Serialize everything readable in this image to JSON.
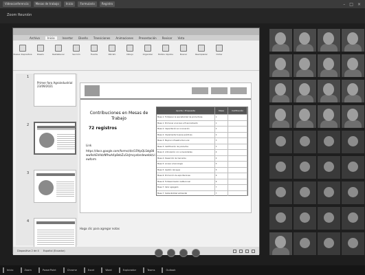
{
  "top_tabs": [
    "Videoconferencia",
    "Mesas de trabajo",
    "Inicio",
    "Formulario",
    "Registro"
  ],
  "meeting": {
    "title": "Zoom Reunión"
  },
  "powerpoint": {
    "tabs": [
      "Archivo",
      "Inicio",
      "Insertar",
      "Diseño",
      "Transiciones",
      "Animaciones",
      "Presentación",
      "Revisar",
      "Vista"
    ],
    "ribbon": [
      "Nueva diapositiva",
      "Diseño",
      "Restablecer",
      "Sección",
      "Fuente",
      "Párrafo",
      "Dibujo",
      "Organizar",
      "Estilos rápidos",
      "Buscar",
      "Reemplazar",
      "Dictar"
    ],
    "thumbs": [
      {
        "num": "1",
        "title": "Primer foro Agroindustrial 23/09/2021"
      },
      {
        "num": "2",
        "title": ""
      },
      {
        "num": "3",
        "title": ""
      },
      {
        "num": "4",
        "title": ""
      }
    ],
    "slide": {
      "heading": "Contribuciones en Mesas de Trabajo",
      "count": "72 registros",
      "link_label": "Link",
      "link": "https://docs.google.com/forms/d/e/1FAIpQLSdg08ww9ohEhAdzNfhwh4p8ebZuSlcJmcpnbndewebk/viewform",
      "table_headers": [
        "Aporte / Propuesta",
        "Mesa",
        "Calificación"
      ],
      "table_rows": [
        [
          "Mesa 1: Fortalecer la asociatividad de productores",
          "1",
          ""
        ],
        [
          "Mesa 1: Promover el acceso a financiamiento",
          "1",
          ""
        ],
        [
          "Mesa 2: Capacitación en innovación",
          "2",
          ""
        ],
        [
          "Mesa 2: Implementar buenas prácticas",
          "2",
          ""
        ],
        [
          "Mesa 3: Mejorar infraestructura vial",
          "3",
          ""
        ],
        [
          "Mesa 3: Certificación de productos",
          "3",
          ""
        ],
        [
          "Mesa 4: Articulación con universidades",
          "4",
          ""
        ],
        [
          "Mesa 4: Desarrollo de mercados",
          "4",
          ""
        ],
        [
          "Mesa 5: Acceso a tecnología",
          "5",
          ""
        ],
        [
          "Mesa 5: Gestión del agua",
          "5",
          ""
        ],
        [
          "Mesa 6: Promoción de exportaciones",
          "6",
          ""
        ],
        [
          "Mesa 6: Fortalecimiento institucional",
          "6",
          ""
        ],
        [
          "Mesa 7: Valor agregado",
          "7",
          ""
        ],
        [
          "Mesa 7: Sostenibilidad ambiental",
          "7",
          ""
        ]
      ]
    },
    "notes": "Haga clic para agregar notas",
    "status": {
      "slide_info": "Diapositiva 2 de 4",
      "language": "Español (Ecuador)"
    }
  },
  "participants": [
    {
      "name": "",
      "type": "video"
    },
    {
      "name": "",
      "type": "video"
    },
    {
      "name": "",
      "type": "video"
    },
    {
      "name": "",
      "type": "video"
    },
    {
      "name": "",
      "type": "video"
    },
    {
      "name": "",
      "type": "video"
    },
    {
      "name": "",
      "type": "video"
    },
    {
      "name": "",
      "type": "video"
    },
    {
      "name": "",
      "type": "video"
    },
    {
      "name": "",
      "type": "video"
    },
    {
      "name": "",
      "type": "video"
    },
    {
      "name": "",
      "type": "video"
    },
    {
      "name": "",
      "type": "video"
    },
    {
      "name": "",
      "type": "video"
    },
    {
      "name": "",
      "type": "video"
    },
    {
      "name": "",
      "type": "video"
    },
    {
      "name": "",
      "type": "avatar",
      "initial": ""
    },
    {
      "name": "",
      "type": "avatar",
      "initial": ""
    },
    {
      "name": "",
      "type": "avatar",
      "initial": ""
    },
    {
      "name": "",
      "type": "avatar",
      "initial": ""
    },
    {
      "name": "",
      "type": "avatar",
      "initial": ""
    },
    {
      "name": "",
      "type": "avatar",
      "initial": ""
    },
    {
      "name": "",
      "type": "avatar",
      "initial": ""
    },
    {
      "name": "",
      "type": "avatar",
      "initial": ""
    },
    {
      "name": "",
      "type": "avatar",
      "initial": ""
    },
    {
      "name": "",
      "type": "avatar",
      "initial": ""
    },
    {
      "name": "",
      "type": "avatar",
      "initial": ""
    },
    {
      "name": "",
      "type": "avatar",
      "initial": ""
    },
    {
      "name": "",
      "type": "avatar",
      "initial": ""
    },
    {
      "name": "",
      "type": "avatar",
      "initial": ""
    },
    {
      "name": "",
      "type": "avatar",
      "initial": ""
    },
    {
      "name": "",
      "type": "avatar",
      "initial": ""
    },
    {
      "name": "",
      "type": "video"
    },
    {
      "name": "",
      "type": "avatar",
      "initial": ""
    },
    {
      "name": "",
      "type": "avatar",
      "initial": ""
    },
    {
      "name": "",
      "type": "avatar",
      "initial": ""
    }
  ],
  "taskbar": [
    "Inicio",
    "Zoom",
    "PowerPoint",
    "Chrome",
    "Excel",
    "Word",
    "Explorador",
    "Teams",
    "Outlook"
  ]
}
